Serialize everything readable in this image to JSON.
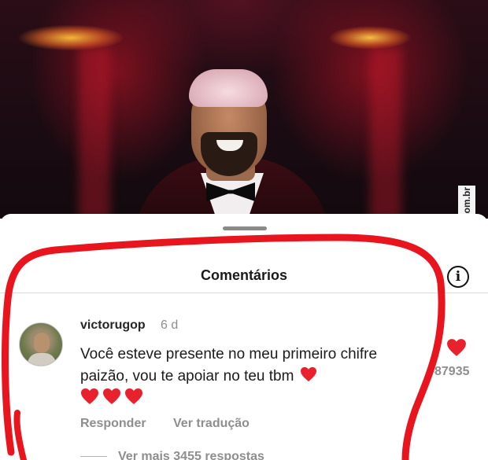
{
  "watermark": "AhNegao.com.br",
  "sheet": {
    "title": "Comentários"
  },
  "comment": {
    "username": "victorugop",
    "time": "6 d",
    "text": "Você esteve presente no meu primeiro chifre paizão, vou te apoiar no teu tbm",
    "emoji_hearts_count": 4,
    "reply_label": "Responder",
    "translate_label": "Ver tradução",
    "like_count": "87935",
    "more_replies_label": "Ver mais 3455 respostas"
  },
  "colors": {
    "heart_red": "#e8212d",
    "annotation_red": "#e8141e",
    "muted_text": "#8e8e8e"
  },
  "icons": {
    "info": "info-icon",
    "like": "heart-icon",
    "emoji": "red-heart-emoji"
  }
}
